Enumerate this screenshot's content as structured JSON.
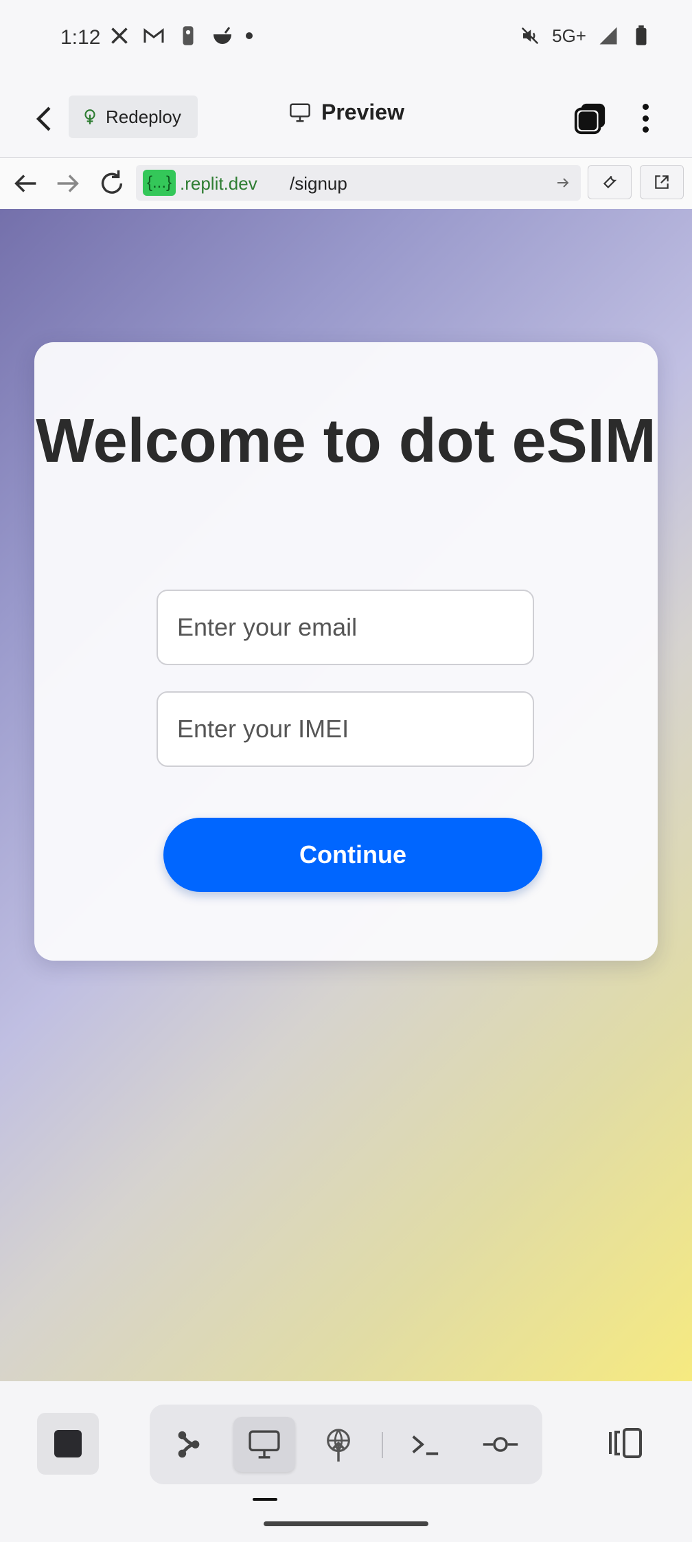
{
  "status_bar": {
    "time": "1:12",
    "network": "5G+",
    "left_icons": [
      "x-icon",
      "gmail-icon",
      "nba-icon",
      "bowl-icon",
      "dot-icon"
    ],
    "right_icons": [
      "mute-icon",
      "signal-icon",
      "battery-icon"
    ]
  },
  "app_header": {
    "redeploy_label": "Redeploy",
    "title": "Preview"
  },
  "url_bar": {
    "badge": "{...}",
    "domain": ".replit.dev",
    "path": "/signup"
  },
  "page": {
    "title": "Welcome to dot eSIM",
    "email_placeholder": "Enter your email",
    "imei_placeholder": "Enter your IMEI",
    "continue_label": "Continue"
  },
  "bottom_toolbar": {
    "active_tab": "preview",
    "tabs": [
      "agent-icon",
      "preview-icon",
      "deploy-icon",
      "shell-icon",
      "git-icon"
    ]
  },
  "colors": {
    "primary": "#0066ff",
    "url_badge": "#34c759",
    "gradient_start": "#7470ab",
    "gradient_end": "#f6ea80"
  }
}
